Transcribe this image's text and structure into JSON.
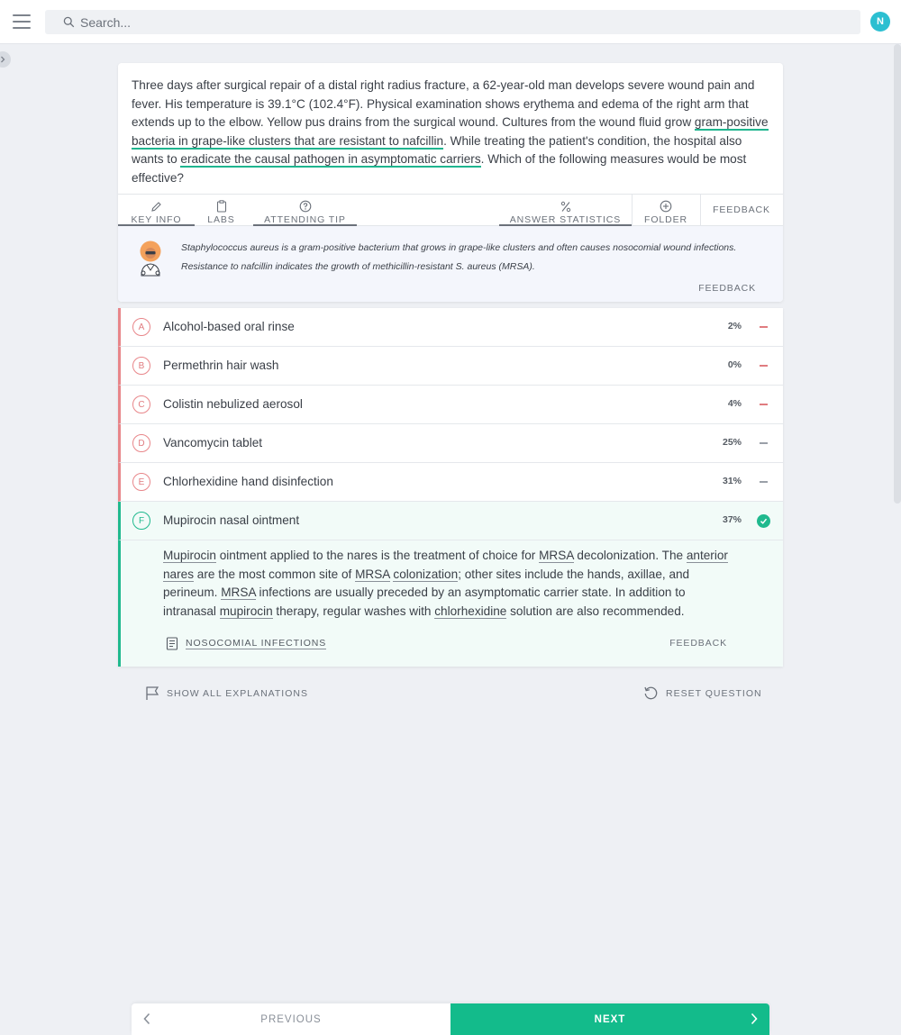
{
  "search": {
    "placeholder": "Search..."
  },
  "user": {
    "avatar_initial": "N",
    "avatar_color": "#2cbfd1"
  },
  "question": {
    "parts": [
      "Three days after surgical repair of a distal right radius fracture, a 62-year-old man develops severe wound pain and fever. His temperature is 39.1°C (102.4°F). Physical examination shows erythema and edema of the right arm that extends up to the elbow. Yellow pus drains from the surgical wound. Cultures from the wound fluid grow ",
      "gram-positive bacteria in grape-like clusters that are resistant to nafcillin",
      ". While treating the patient's condition, the hospital also wants to ",
      "eradicate the causal pathogen in asymptomatic carriers",
      ". Which of the following measures would be most effective?"
    ]
  },
  "tabs": {
    "key_info": "KEY INFO",
    "labs": "LABS",
    "attending_tip": "ATTENDING TIP",
    "answer_statistics": "ANSWER STATISTICS",
    "folder": "FOLDER",
    "feedback": "FEEDBACK"
  },
  "tip": {
    "text": "Staphylococcus aureus is a gram-positive bacterium that grows in grape-like clusters and often causes nosocomial wound infections. Resistance to nafcillin indicates the growth of methicillin-resistant S. aureus (MRSA).",
    "feedback": "FEEDBACK"
  },
  "answers": [
    {
      "letter": "A",
      "text": "Alcohol-based oral rinse",
      "percent": "2%"
    },
    {
      "letter": "B",
      "text": "Permethrin hair wash",
      "percent": "0%"
    },
    {
      "letter": "C",
      "text": "Colistin nebulized aerosol",
      "percent": "4%"
    },
    {
      "letter": "D",
      "text": "Vancomycin tablet",
      "percent": "25%"
    },
    {
      "letter": "E",
      "text": "Chlorhexidine hand disinfection",
      "percent": "31%"
    },
    {
      "letter": "F",
      "text": "Mupirocin nasal ointment",
      "percent": "37%"
    }
  ],
  "explanation": {
    "parts": [
      "Mupirocin",
      " ointment applied to the nares is the treatment of choice for ",
      "MRSA",
      " decolonization. The ",
      "anterior nares",
      " are the most common site of ",
      "MRSA",
      " ",
      "colonization",
      "; other sites include the hands, axillae, and perineum. ",
      "MRSA",
      " infections are usually preceded by an asymptomatic carrier state. In addition to intranasal ",
      "mupirocin",
      " therapy, regular washes with ",
      "chlorhexidine",
      " solution are also recommended."
    ],
    "link": "NOSOCOMIAL INFECTIONS",
    "feedback": "FEEDBACK"
  },
  "actions": {
    "show_all": "SHOW ALL EXPLANATIONS",
    "reset": "RESET QUESTION"
  },
  "nav": {
    "previous": "PREVIOUS",
    "next": "NEXT"
  },
  "colors": {
    "accent": "#13bb8b",
    "correct": "#20b98e",
    "incorrect": "#e8868a"
  }
}
